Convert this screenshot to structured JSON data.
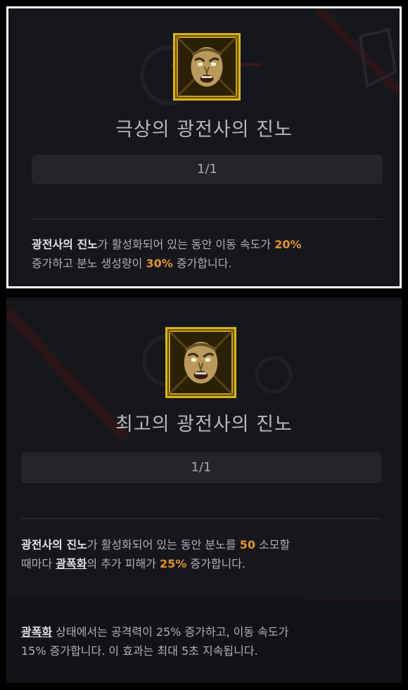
{
  "panel_top": {
    "title": "극상의 광전사의 진노",
    "level": "1/1",
    "desc": {
      "keyword": "광전사의 진노",
      "part1": "가 활성화되어 있는 동안 이동 속도가 ",
      "value1": "20%",
      "part2": "증가하고 분노 생성량이 ",
      "value2": "30%",
      "part3": " 증가합니다."
    }
  },
  "panel_bottom": {
    "title": "최고의 광전사의 진노",
    "level": "1/1",
    "desc": {
      "keyword": "광전사의 진노",
      "part1": "가 활성화되어 있는 동안 분노를 ",
      "value1": "50",
      "part2": " 소모할",
      "part3": "때마다 ",
      "link": "광폭화",
      "part4": "의 추가 피해가 ",
      "value2": "25%",
      "part5": " 증가합니다."
    },
    "note": {
      "link": "광폭화",
      "line1": " 상태에서는 공격력이 25% 증가하고, 이동 속도가",
      "line2": "15% 증가합니다. 이 효과는 최대 5초 지속됩니다."
    }
  },
  "colors": {
    "accent_value": "#e3902f",
    "icon_border": "#d8b21c",
    "panel_bg": "#16171b"
  },
  "icons": [
    "berserker-face-icon"
  ]
}
